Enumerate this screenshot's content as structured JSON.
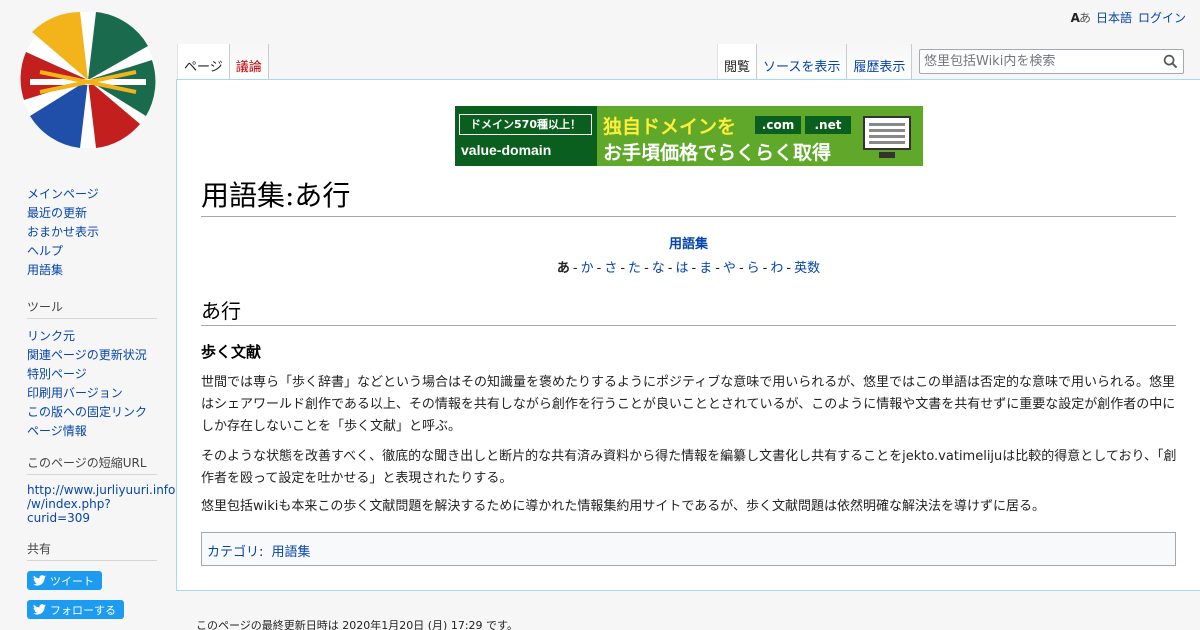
{
  "personal": {
    "lang_icon_a": "A",
    "lang_icon_b": "あ",
    "language": "日本語",
    "login": "ログイン"
  },
  "tabs_left": [
    {
      "label": "ページ"
    },
    {
      "label": "議論"
    }
  ],
  "tabs_right": [
    {
      "label": "閲覧"
    },
    {
      "label": "ソースを表示"
    },
    {
      "label": "履歴表示"
    }
  ],
  "search": {
    "placeholder": "悠里包括Wiki内を検索"
  },
  "banner": {
    "badge": "ドメイン570種以上！",
    "brand": "value-domain",
    "line1": "独自ドメインを",
    "line2": "お手頃価格でらくらく取得",
    "tld1": ".com",
    "tld2": ".net"
  },
  "page": {
    "title": "用語集:あ行",
    "nav_title": "用語集",
    "nav": [
      "あ",
      "か",
      "さ",
      "た",
      "な",
      "は",
      "ま",
      "や",
      "ら",
      "わ",
      "英数"
    ],
    "section": "あ行",
    "term": "歩く文献",
    "p1": "世間では専ら「歩く辞書」などという場合はその知識量を褒めたりするようにポジティブな意味で用いられるが、悠里ではこの単語は否定的な意味で用いられる。悠里はシェアワールド創作である以上、その情報を共有しながら創作を行うことが良いこととされているが、このように情報や文書を共有せずに重要な設定が創作者の中にしか存在しないことを「歩く文献」と呼ぶ。",
    "p2": "そのような状態を改善すべく、徹底的な聞き出しと断片的な共有済み資料から得た情報を編纂し文書化し共有することをjekto.vatimelijuは比較的得意としており、「創作者を殴って設定を吐かせる」と表現されたりする。",
    "p3": "悠里包括wikiも本来この歩く文献問題を解決するために導かれた情報集約用サイトであるが、歩く文献問題は依然明確な解決法を導けずに居る。",
    "cat_label": "カテゴリ",
    "cat_value": "用語集"
  },
  "sidebar": {
    "main": [
      "メインページ",
      "最近の更新",
      "おまかせ表示",
      "ヘルプ",
      "用語集"
    ],
    "tools_heading": "ツール",
    "tools": [
      "リンク元",
      "関連ページの更新状況",
      "特別ページ",
      "印刷用バージョン",
      "この版への固定リンク",
      "ページ情報"
    ],
    "short_heading": "このページの短縮URL",
    "short_url": [
      "http://www.jurliyuuri.info",
      "/w/index.php?",
      "curid=309"
    ],
    "share_heading": "共有",
    "tweet": "ツイート",
    "follow": "フォローする"
  },
  "footer": {
    "last_modified": "このページの最終更新日時は 2020年1月20日 (月) 17:29 です。"
  },
  "colors": {
    "link": "#0645ad",
    "new_link": "#ba0000",
    "twitter": "#1d9bf0"
  }
}
